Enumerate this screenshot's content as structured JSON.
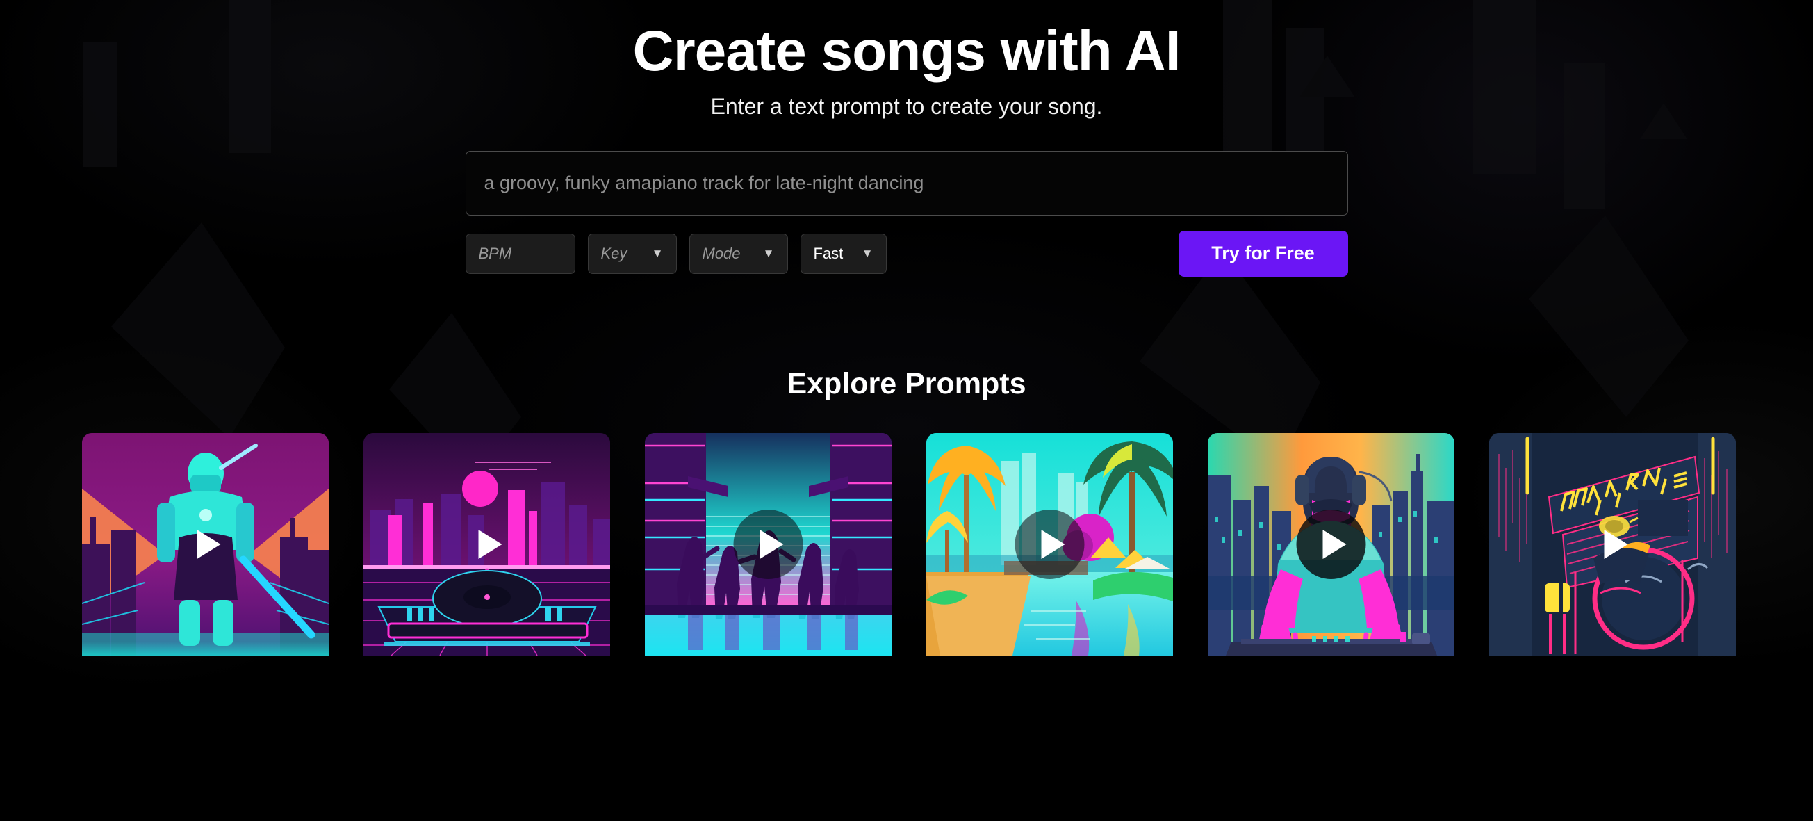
{
  "hero": {
    "title": "Create songs with AI",
    "subtitle": "Enter a text prompt to create your song."
  },
  "form": {
    "prompt_placeholder": "a groovy, funky amapiano track for late-night dancing",
    "prompt_value": "",
    "bpm_placeholder": "BPM",
    "bpm_value": "",
    "key_label": "Key",
    "mode_label": "Mode",
    "speed_label": "Fast",
    "caret_glyph": "▼",
    "cta_label": "Try for Free",
    "cta_color": "#6b16f5"
  },
  "explore": {
    "title": "Explore Prompts",
    "play_icon": "play-icon",
    "cards": [
      {
        "name": "cyberpunk-samurai",
        "alt": "Neon cyberpunk samurai knight with glowing sword in a purple city",
        "play_style": "none"
      },
      {
        "name": "synthwave-turntable",
        "alt": "Synthwave turntable with magenta skyline and pink sun",
        "play_style": "none"
      },
      {
        "name": "neon-street-dancers",
        "alt": "Silhouetted dancers on a neon street with teal sky",
        "play_style": "soft"
      },
      {
        "name": "tropical-canal",
        "alt": "Tropical canal with palm trees and turquoise water",
        "play_style": "soft"
      },
      {
        "name": "dj-headphones",
        "alt": "DJ wearing headphones at a mixer against a city skyline",
        "play_style": "strong"
      },
      {
        "name": "neon-sign-drums",
        "alt": "Neon sign over a drum kit in a dark blue alley",
        "play_style": "none"
      }
    ]
  }
}
